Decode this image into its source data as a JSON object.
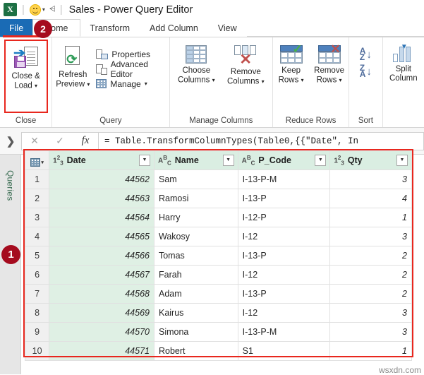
{
  "window": {
    "title": "Sales - Power Query Editor",
    "app_icon": "excel-icon",
    "qat_smiley": "smiley-icon",
    "qat_caret": "▾",
    "qat_more": "▾"
  },
  "ribbon": {
    "tabs": [
      {
        "label": "File",
        "id": "file"
      },
      {
        "label": "Home",
        "id": "home"
      },
      {
        "label": "Transform",
        "id": "transform"
      },
      {
        "label": "Add Column",
        "id": "add-column"
      },
      {
        "label": "View",
        "id": "view"
      }
    ],
    "groups": [
      {
        "label": "Close",
        "buttons": [
          {
            "label_line1": "Close &",
            "label_line2": "Load",
            "has_caret": true
          }
        ]
      },
      {
        "label": "Query",
        "buttons": [
          {
            "label_line1": "Refresh",
            "label_line2": "Preview",
            "has_caret": true
          }
        ],
        "small_buttons": [
          {
            "label": "Properties",
            "icon": "properties-icon"
          },
          {
            "label": "Advanced Editor",
            "icon": "advanced-editor-icon"
          },
          {
            "label": "Manage",
            "icon": "manage-icon",
            "has_caret": true
          }
        ]
      },
      {
        "label": "Manage Columns",
        "buttons": [
          {
            "label_line1": "Choose",
            "label_line2": "Columns",
            "has_caret": true
          },
          {
            "label_line1": "Remove",
            "label_line2": "Columns",
            "has_caret": true
          }
        ]
      },
      {
        "label": "Reduce Rows",
        "buttons": [
          {
            "label_line1": "Keep",
            "label_line2": "Rows",
            "has_caret": true
          },
          {
            "label_line1": "Remove",
            "label_line2": "Rows",
            "has_caret": true
          }
        ]
      },
      {
        "label": "Sort",
        "buttons": [
          {
            "label_line1": "A",
            "label_line2": "Z",
            "has_caret": false
          },
          {
            "label_line1": "Z",
            "label_line2": "A",
            "has_caret": false
          }
        ]
      },
      {
        "label": "",
        "buttons": [
          {
            "label_line1": "Split",
            "label_line2": "Column",
            "has_caret": false
          }
        ]
      }
    ]
  },
  "formula_bar": {
    "cancel_icon": "✕",
    "accept_icon": "✓",
    "fx_icon": "fx",
    "value": "= Table.TransformColumnTypes(Table0,{{\"Date\", In",
    "expand_chevron": "❯"
  },
  "queries_pane": {
    "label": "Queries",
    "expand_icon": "❯"
  },
  "annotations": {
    "marker_1": "1",
    "marker_2": "2",
    "highlight_color": "#e8271e",
    "marker_color": "#a50b1e"
  },
  "grid": {
    "corner_icon": "table-corner-icon",
    "filter_caret": "▼",
    "columns": [
      {
        "name": "Date",
        "type_icon": "123",
        "type": "number"
      },
      {
        "name": "Name",
        "type_icon": "ABC",
        "type": "text"
      },
      {
        "name": "P_Code",
        "type_icon": "ABC",
        "type": "text"
      },
      {
        "name": "Qty",
        "type_icon": "123",
        "type": "number"
      }
    ],
    "rows": [
      {
        "n": "1",
        "Date": "44562",
        "Name": "Sam",
        "P_Code": "I-13-P-M",
        "Qty": "3"
      },
      {
        "n": "2",
        "Date": "44563",
        "Name": "Ramosi",
        "P_Code": "I-13-P",
        "Qty": "4"
      },
      {
        "n": "3",
        "Date": "44564",
        "Name": "Harry",
        "P_Code": "I-12-P",
        "Qty": "1"
      },
      {
        "n": "4",
        "Date": "44565",
        "Name": "Wakosy",
        "P_Code": "I-12",
        "Qty": "3"
      },
      {
        "n": "5",
        "Date": "44566",
        "Name": "Tomas",
        "P_Code": "I-13-P",
        "Qty": "2"
      },
      {
        "n": "6",
        "Date": "44567",
        "Name": "Farah",
        "P_Code": "I-12",
        "Qty": "2"
      },
      {
        "n": "7",
        "Date": "44568",
        "Name": "Adam",
        "P_Code": "I-13-P",
        "Qty": "2"
      },
      {
        "n": "8",
        "Date": "44569",
        "Name": "Kairus",
        "P_Code": "I-12",
        "Qty": "3"
      },
      {
        "n": "9",
        "Date": "44570",
        "Name": "Simona",
        "P_Code": "I-13-P-M",
        "Qty": "3"
      },
      {
        "n": "10",
        "Date": "44571",
        "Name": "Robert",
        "P_Code": "S1",
        "Qty": "1"
      }
    ]
  },
  "watermark": "wsxdn.com"
}
